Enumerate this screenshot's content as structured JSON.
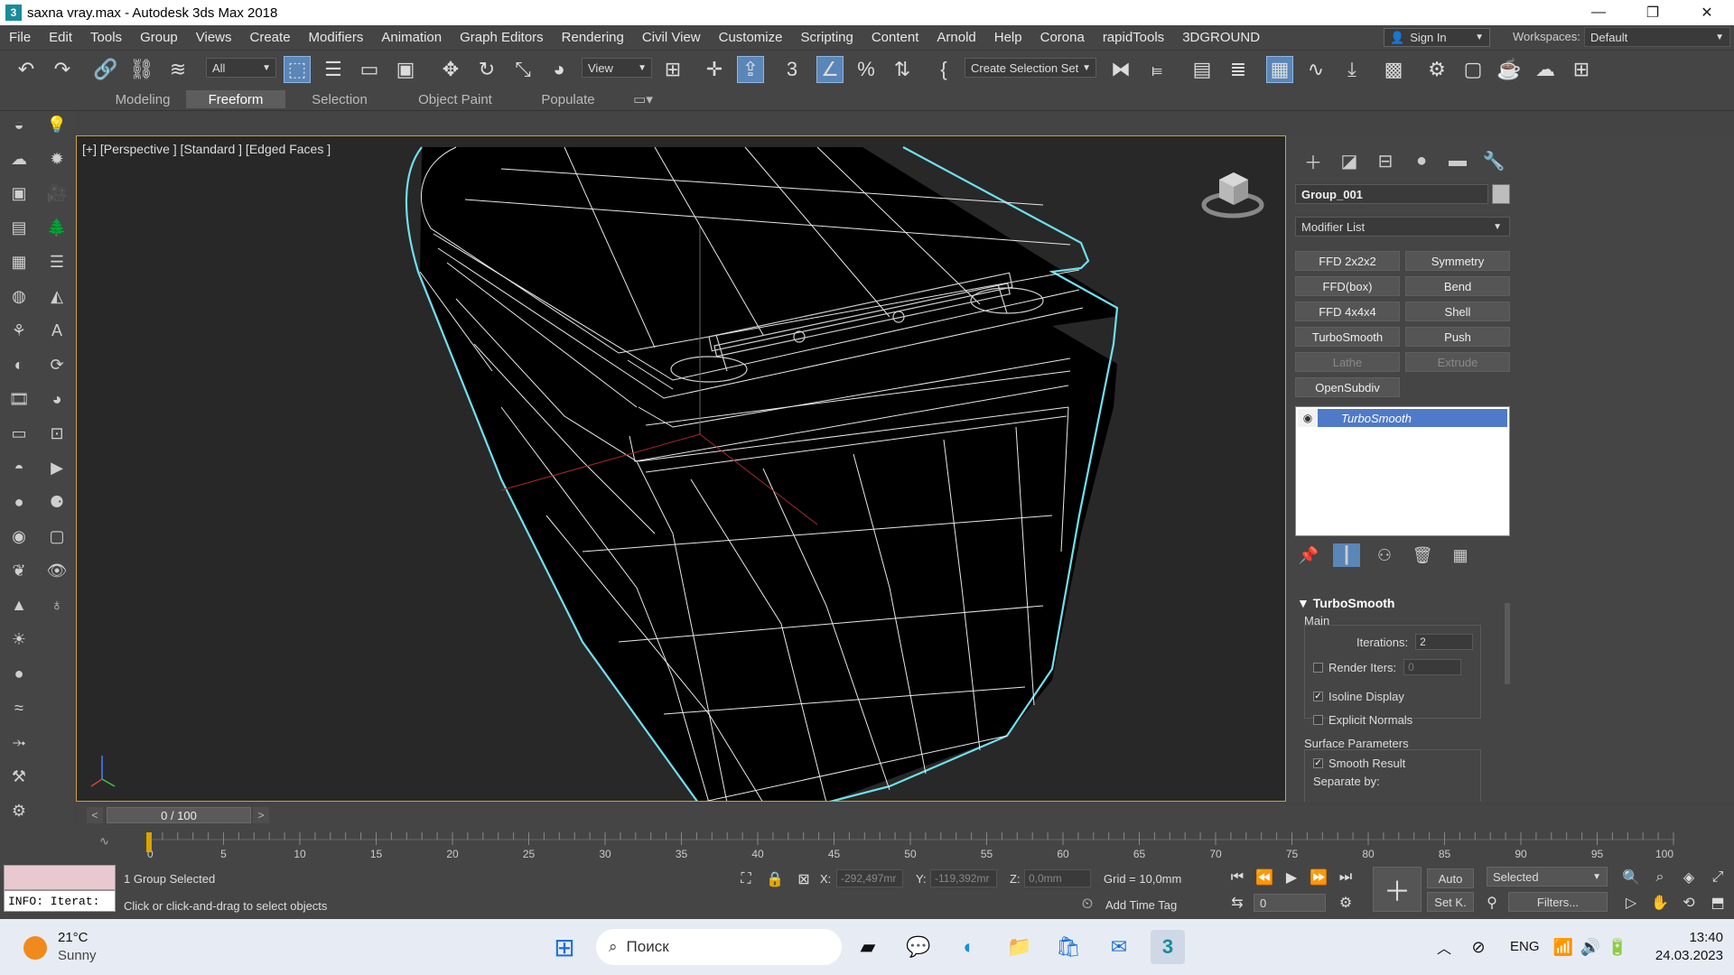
{
  "window": {
    "title": "saxna vray.max - Autodesk 3ds Max 2018",
    "app_icon": "3",
    "minimize": "—",
    "restore": "❐",
    "close": "✕"
  },
  "menu": [
    "File",
    "Edit",
    "Tools",
    "Group",
    "Views",
    "Create",
    "Modifiers",
    "Animation",
    "Graph Editors",
    "Rendering",
    "Civil View",
    "Customize",
    "Scripting",
    "Content",
    "Arnold",
    "Help",
    "Corona",
    "rapidTools",
    "3DGROUND"
  ],
  "account": {
    "signin": "Sign In",
    "workspaces_label": "Workspaces:",
    "workspace": "Default"
  },
  "toolbar": {
    "filter": "All",
    "ref_coord": "View",
    "selection_set": "Create Selection Set"
  },
  "ribbon_tabs": [
    "Modeling",
    "Freeform",
    "Selection",
    "Object Paint",
    "Populate"
  ],
  "ribbon_active": "Freeform",
  "viewport": {
    "label": "[+] [Perspective ] [Standard ] [Edged Faces ]"
  },
  "command_panel": {
    "object_name": "Group_001",
    "modifier_list": "Modifier List",
    "modifier_buttons": [
      {
        "label": "FFD 2x2x2",
        "enabled": true
      },
      {
        "label": "Symmetry",
        "enabled": true
      },
      {
        "label": "FFD(box)",
        "enabled": true
      },
      {
        "label": "Bend",
        "enabled": true
      },
      {
        "label": "FFD 4x4x4",
        "enabled": true
      },
      {
        "label": "Shell",
        "enabled": true
      },
      {
        "label": "TurboSmooth",
        "enabled": true
      },
      {
        "label": "Push",
        "enabled": true
      },
      {
        "label": "Lathe",
        "enabled": false
      },
      {
        "label": "Extrude",
        "enabled": false
      },
      {
        "label": "OpenSubdiv",
        "enabled": true
      }
    ],
    "stack_item": "TurboSmooth",
    "rollout": {
      "title": "TurboSmooth",
      "main_label": "Main",
      "iterations_label": "Iterations:",
      "iterations_value": "2",
      "render_iters_label": "Render Iters:",
      "render_iters_value": "0",
      "render_iters_checked": false,
      "isoline_label": "Isoline Display",
      "isoline_checked": true,
      "explicit_normals_label": "Explicit Normals",
      "explicit_normals_checked": false,
      "surface_label": "Surface Parameters",
      "smooth_result_label": "Smooth Result",
      "smooth_result_checked": true,
      "separate_label": "Separate by:"
    }
  },
  "timeline": {
    "frame_display": "0 / 100",
    "prev": "<",
    "next": ">",
    "ticks": [
      "0",
      "5",
      "10",
      "15",
      "20",
      "25",
      "30",
      "35",
      "40",
      "45",
      "50",
      "55",
      "60",
      "65",
      "70",
      "75",
      "80",
      "85",
      "90",
      "95",
      "100"
    ]
  },
  "status": {
    "script_output": "INFO: Iterat:",
    "selection": "1 Group Selected",
    "prompt": "Click or click-and-drag to select objects",
    "x_label": "X:",
    "x_value": "-292,497mr",
    "y_label": "Y:",
    "y_value": "-119,392mr",
    "z_label": "Z:",
    "z_value": "0,0mm",
    "grid": "Grid = 10,0mm",
    "add_time_tag": "Add Time Tag",
    "auto": "Auto",
    "set_key": "Set K.",
    "selected": "Selected",
    "filters": "Filters...",
    "frame_value": "0"
  },
  "taskbar": {
    "weather_temp": "21°C",
    "weather_desc": "Sunny",
    "search_placeholder": "Поиск",
    "lang": "ENG",
    "time": "13:40",
    "date": "24.03.2023"
  },
  "colors": {
    "selection_highlight": "#6fe0ee",
    "viewport_border": "#c8a43c",
    "stack_selected": "#4f7ac8"
  }
}
